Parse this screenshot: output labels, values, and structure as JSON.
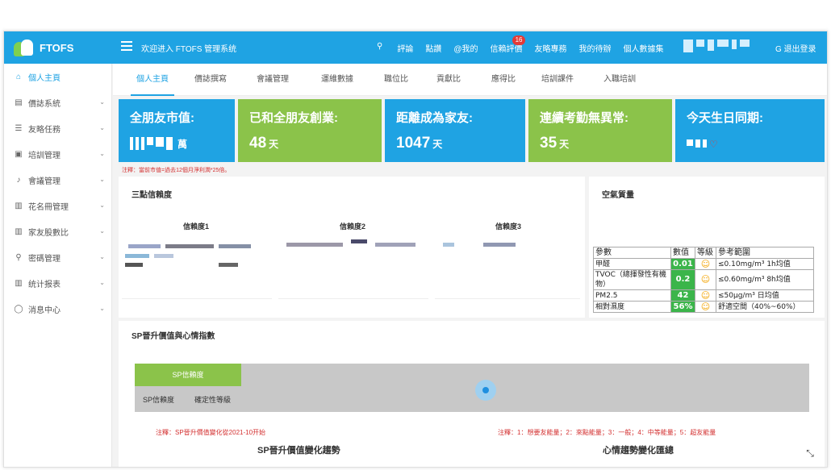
{
  "header": {
    "logo_text": "FTOFS",
    "welcome": "欢迎进入 FTOFS 管理系统",
    "toolbar": [
      {
        "label": "評論",
        "badge": ""
      },
      {
        "label": "點讚",
        "badge": ""
      },
      {
        "label": "@我的",
        "badge": ""
      },
      {
        "label": "信賴評價",
        "badge": "16"
      },
      {
        "label": "友略專務",
        "badge": ""
      },
      {
        "label": "我的待辦",
        "badge": ""
      },
      {
        "label": "個人數據集",
        "badge": ""
      }
    ],
    "logout": "退出登录"
  },
  "sidebar": {
    "items": [
      {
        "label": "個人主頁",
        "icon": "⌂",
        "active": true
      },
      {
        "label": "價誌系統",
        "icon": "▤",
        "active": false
      },
      {
        "label": "友略任務",
        "icon": "☰",
        "active": false
      },
      {
        "label": "培訓管理",
        "icon": "▣",
        "active": false
      },
      {
        "label": "會議管理",
        "icon": "♪",
        "active": false
      },
      {
        "label": "花名冊管理",
        "icon": "▥",
        "active": false
      },
      {
        "label": "家友股數比",
        "icon": "▥",
        "active": false
      },
      {
        "label": "密碼管理",
        "icon": "⚲",
        "active": false
      },
      {
        "label": "统计报表",
        "icon": "▥",
        "active": false
      },
      {
        "label": "消息中心",
        "icon": "◯",
        "active": false
      }
    ]
  },
  "tabs": [
    "個人主頁",
    "價誌撰寫",
    "會議管理",
    "運維數據",
    "職位比",
    "貢獻比",
    "應得比",
    "培訓課件",
    "入職培訓"
  ],
  "stats": [
    {
      "label": "全朋友市值:",
      "value": "",
      "unit": "萬",
      "color": "#1fa3e3"
    },
    {
      "label": "已和全朋友創業:",
      "value": "48",
      "unit": "天",
      "color": "#8bc34a"
    },
    {
      "label": "距離成為家友:",
      "value": "1047",
      "unit": "天",
      "color": "#1fa3e3"
    },
    {
      "label": "連續考勤無異常:",
      "value": "35",
      "unit": "天",
      "color": "#8bc34a"
    },
    {
      "label": "今天生日同期:",
      "value": "",
      "unit": "",
      "color": "#1fa3e3"
    }
  ],
  "note_market": "注釋：當前市值=過去12個月淨利潤*25倍。",
  "trust": {
    "title": "三點信賴度",
    "charts": [
      "信賴度1",
      "信賴度2",
      "信賴度3"
    ]
  },
  "air": {
    "title": "空氣質量",
    "headers": [
      "參數",
      "數值",
      "等級",
      "參考範圍"
    ],
    "rows": [
      {
        "param": "甲醛",
        "value": "0.01",
        "range": "≤0.10mg/m³ 1h均值"
      },
      {
        "param": "TVOC（總揮發性有機物）",
        "value": "0.2",
        "range": "≤0.60mg/m³ 8h均值"
      },
      {
        "param": "PM2.5",
        "value": "42",
        "range": "≤50μg/m³ 日均值"
      },
      {
        "param": "相對濕度",
        "value": "56%",
        "range": "舒適空間（40%~60%）"
      }
    ]
  },
  "sp": {
    "title": "SP晉升價值與心情指數",
    "green_label": "SP信賴度",
    "sub1": "SP信賴度",
    "sub2": "確定性等級",
    "note_left": "注釋：SP晉升價值變化從2021-10开始",
    "note_right": "注釋：1：想要友能量；2：來點能量；3：一般；4：中等能量；5：超友能量",
    "trend_left": "SP晉升價值變化趨勢",
    "trend_right": "心情趨勢變化匯總"
  }
}
